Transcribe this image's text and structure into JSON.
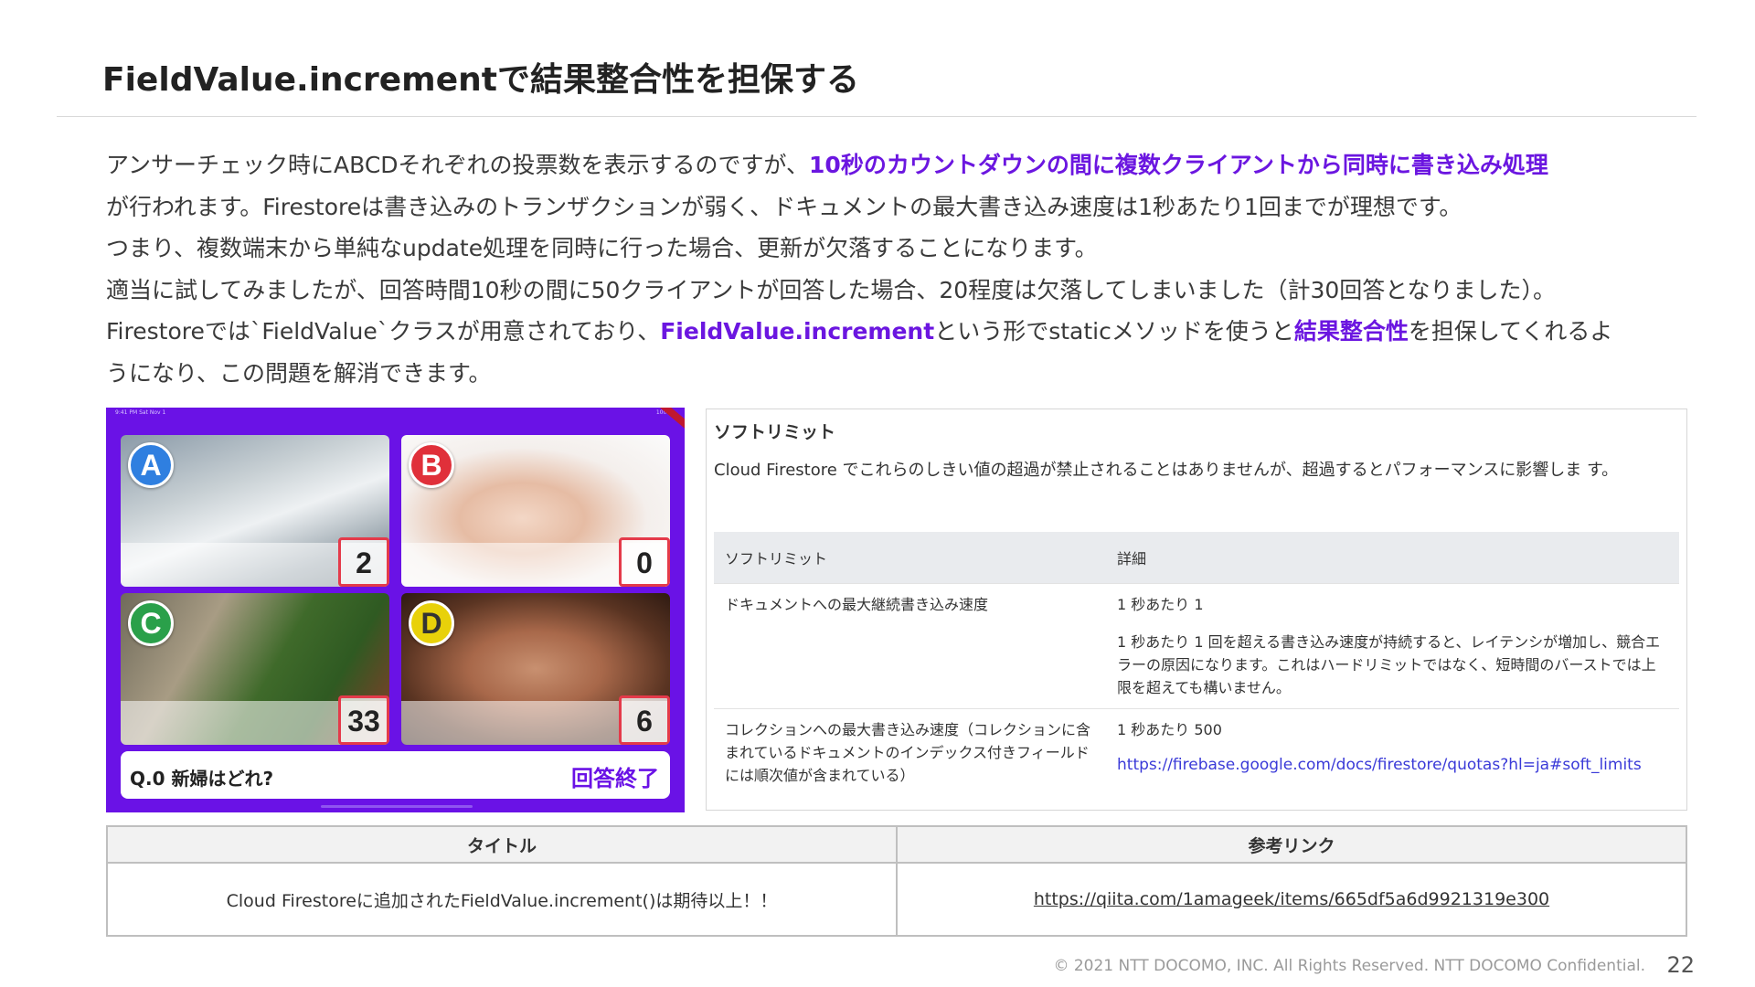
{
  "slide": {
    "title": "FieldValue.incrementで結果整合性を担保する",
    "paragraphs": [
      [
        {
          "text": "アンサーチェック時にABCDそれぞれの投票数を表示するのですが、",
          "hl": false
        },
        {
          "text": "10秒のカウントダウンの間に複数クライアントから同時に書き込み処理",
          "hl": true
        }
      ],
      [
        {
          "text": "が行われます。Firestoreは書き込みのトランザクションが弱く、ドキュメントの最大書き込み速度は1秒あたり1回までが理想です。",
          "hl": false
        }
      ],
      [
        {
          "text": "つまり、複数端末から単純なupdate処理を同時に行った場合、更新が欠落することになります。",
          "hl": false
        }
      ],
      [
        {
          "text": "適当に試してみましたが、回答時間10秒の間に50クライアントが回答した場合、20程度は欠落してしまいました（計30回答となりました）。",
          "hl": false
        }
      ],
      [
        {
          "text": "Firestoreでは`FieldValue`クラスが用意されており、",
          "hl": false
        },
        {
          "text": "FieldValue.increment",
          "hl": true
        },
        {
          "text": "という形でstaticメソッドを使うと",
          "hl": false
        },
        {
          "text": "結果整合性",
          "hl": true
        },
        {
          "text": "を担保してくれるよ",
          "hl": false
        }
      ],
      [
        {
          "text": "うになり、この問題を解消できます。",
          "hl": false
        }
      ]
    ]
  },
  "quiz": {
    "status_left": "9:41 PM  Sat Nov 1",
    "status_right": "100%",
    "options": [
      {
        "letter": "A",
        "count": "2",
        "badge_color": "#2f7fe0"
      },
      {
        "letter": "B",
        "count": "0",
        "badge_color": "#e0303a"
      },
      {
        "letter": "C",
        "count": "33",
        "badge_color": "#2aa04a"
      },
      {
        "letter": "D",
        "count": "6",
        "badge_color": "#e8d10a"
      }
    ],
    "question": "Q.0 新婦はどれ?",
    "status_label": "回答終了"
  },
  "softlimit": {
    "heading": "ソフトリミット",
    "description": "Cloud Firestore でこれらのしきい値の超過が禁止されることはありませんが、超過するとパフォーマンスに影響しま す。",
    "col_limit": "ソフトリミット",
    "col_detail": "詳細",
    "row1_name": "ドキュメントへの最大継続書き込み速度",
    "row1_value": "1 秒あたり 1",
    "row1_note": "1 秒あたり 1 回を超える書き込み速度が持続すると、レイテンシが増加し、競合エラーの原因になります。これはハードリミットではなく、短時間のバーストでは上限を超えても構いません。",
    "row2_name": "コレクションへの最大書き込み速度（コレクションに含まれているドキュメントのインデックス付きフィールドには順次値が含まれている）",
    "row2_value": "1 秒あたり 500",
    "link": "https://firebase.google.com/docs/firestore/quotas?hl=ja#soft_limits"
  },
  "reference": {
    "col_title": "タイトル",
    "col_link": "参考リンク",
    "title": "Cloud Firestoreに追加されたFieldValue.increment()は期待以上！！",
    "link": "https://qiita.com/1amageek/items/665df5a6d9921319e300"
  },
  "footer": {
    "copyright": "© 2021 NTT DOCOMO, INC. All Rights Reserved. NTT DOCOMO Confidential.",
    "page": "22"
  }
}
